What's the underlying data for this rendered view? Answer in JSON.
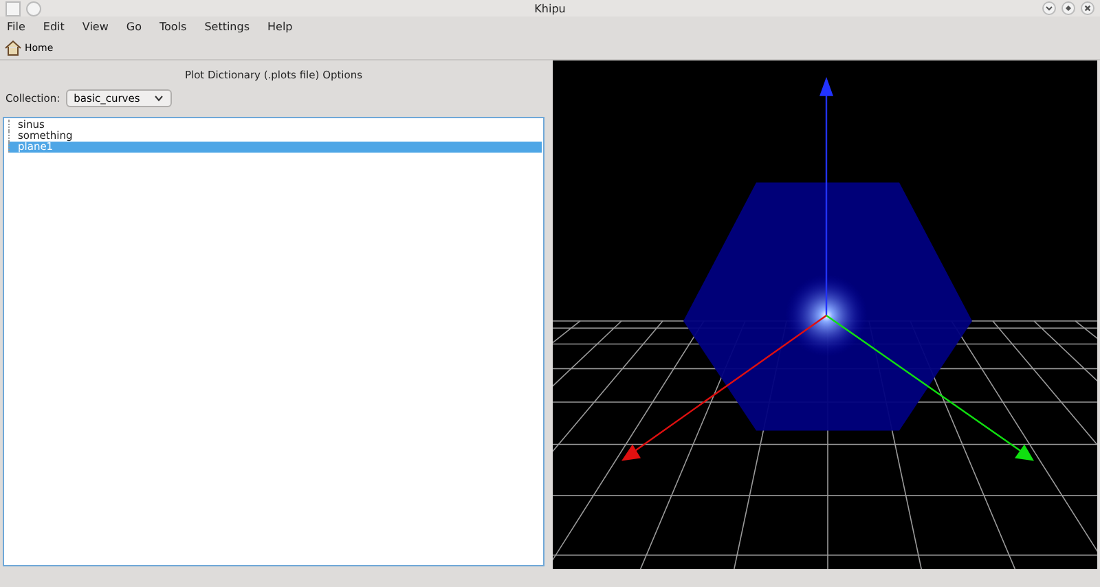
{
  "window": {
    "title": "Khipu"
  },
  "menu": [
    {
      "label": "File"
    },
    {
      "label": "Edit"
    },
    {
      "label": "View"
    },
    {
      "label": "Go"
    },
    {
      "label": "Tools"
    },
    {
      "label": "Settings"
    },
    {
      "label": "Help"
    }
  ],
  "toolbar": {
    "home": "Home"
  },
  "panel": {
    "title": "Plot Dictionary (.plots file) Options",
    "collection_label": "Collection:",
    "collection_value": "basic_curves"
  },
  "items": [
    {
      "label": "sinus",
      "selected": false
    },
    {
      "label": "something",
      "selected": false
    },
    {
      "label": "plane1",
      "selected": true
    }
  ]
}
